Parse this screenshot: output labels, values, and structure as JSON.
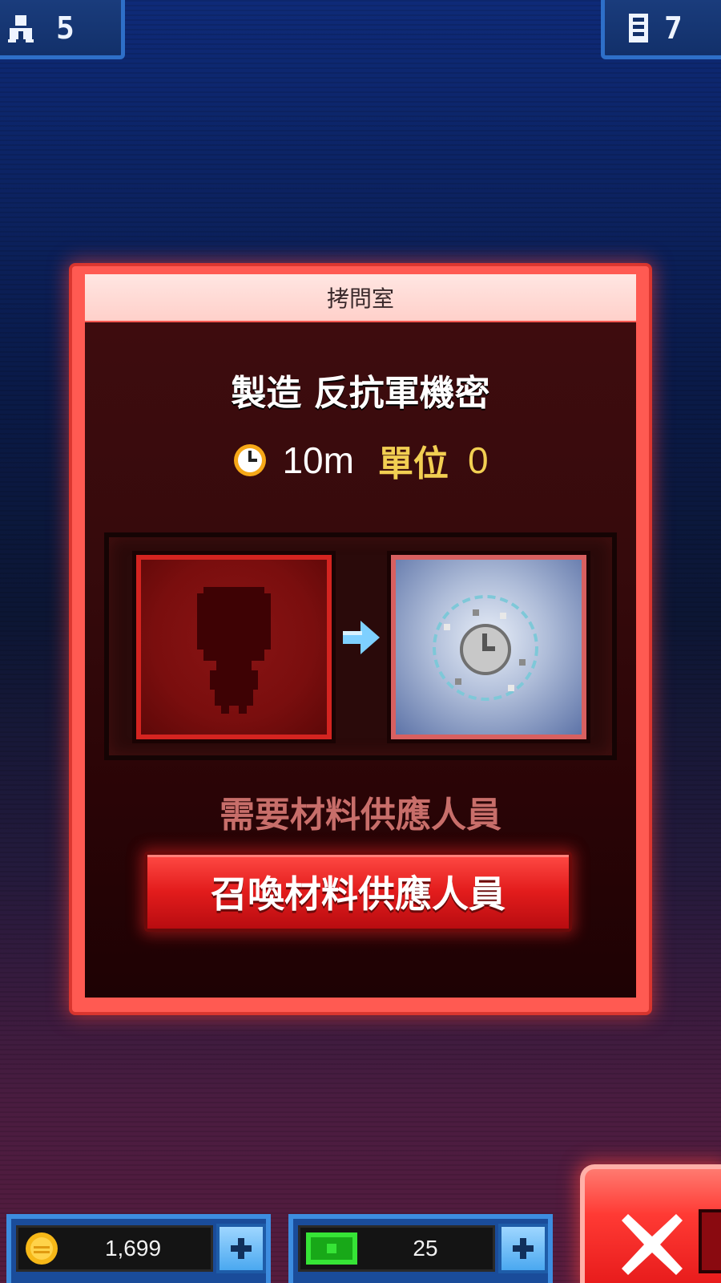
{
  "top_bar": {
    "population_value": "5",
    "floors_value": "7"
  },
  "modal": {
    "title": "拷問室",
    "produce_title": "製造 反抗軍機密",
    "time": "10m",
    "unit_label": "單位",
    "unit_value": "0",
    "need_text": "需要材料供應人員",
    "summon_button": "召喚材料供應人員"
  },
  "bottom_bar": {
    "coins": "1,699",
    "bux": "25"
  },
  "colors": {
    "modal_border": "#ff5a52",
    "modal_body": "#360a0c",
    "accent_gold": "#f2cf52",
    "button_red": "#e21c1c"
  }
}
